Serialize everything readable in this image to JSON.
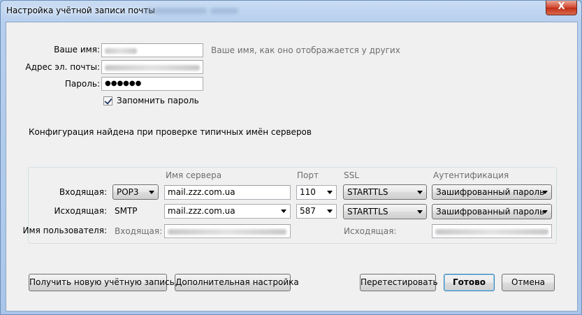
{
  "window": {
    "title": "Настройка учётной записи почты",
    "close_glyph": "X"
  },
  "form": {
    "name_label": "Ваше имя:",
    "name_hint": "Ваше имя, как оно отображается у других",
    "email_label": "Адрес эл. почты:",
    "password_label": "Пароль:",
    "password_value": "●●●●●●",
    "remember_label": "Запомнить пароль",
    "remember_checked": true
  },
  "status_message": "Конфигурация найдена при проверке типичных имён серверов",
  "servers": {
    "headers": {
      "server": "Имя сервера",
      "port": "Порт",
      "ssl": "SSL",
      "auth": "Аутентификация"
    },
    "incoming": {
      "label": "Входящая:",
      "protocol": "POP3",
      "server": "mail.zzz.com.ua",
      "port": "110",
      "ssl": "STARTTLS",
      "auth": "Зашифрованный пароль"
    },
    "outgoing": {
      "label": "Исходящая:",
      "protocol": "SMTP",
      "server": "mail.zzz.com.ua",
      "port": "587",
      "ssl": "STARTTLS",
      "auth": "Зашифрованный пароль"
    },
    "username": {
      "label": "Имя пользователя:",
      "incoming_label": "Входящая:",
      "outgoing_label": "Исходящая:"
    }
  },
  "buttons": {
    "new_account": "Получить новую учётную запись",
    "advanced": "Дополнительная настройка",
    "retest": "Перетестировать",
    "done": "Готово",
    "cancel": "Отмена"
  }
}
